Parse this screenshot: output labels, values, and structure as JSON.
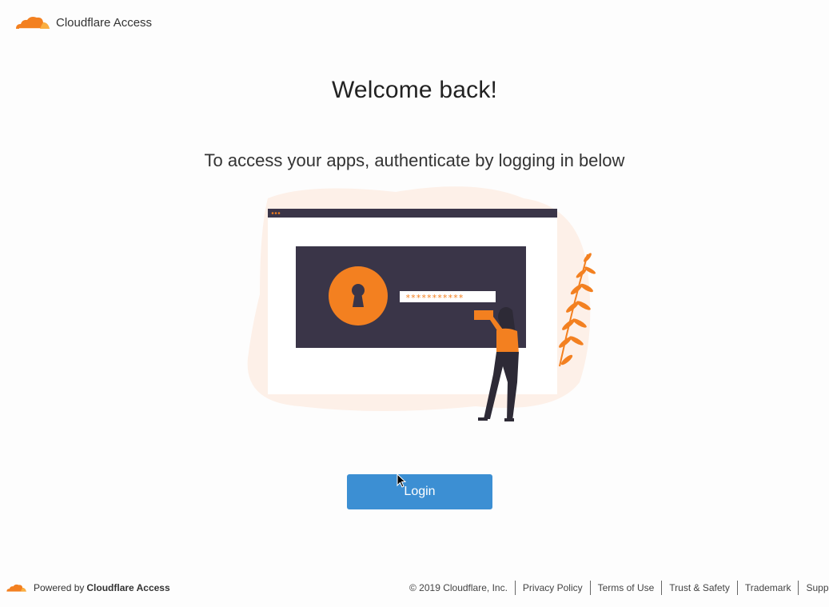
{
  "header": {
    "brand": "Cloudflare Access",
    "logo_icon": "cloudflare-cloud-icon"
  },
  "main": {
    "title": "Welcome back!",
    "subtitle": "To access your apps, authenticate by logging in below",
    "login_label": "Login",
    "password_mask": "***********"
  },
  "footer": {
    "powered_prefix": "Powered by",
    "powered_brand": "Cloudflare Access",
    "copyright": "© 2019 Cloudflare, Inc.",
    "links": [
      "Privacy Policy",
      "Terms of Use",
      "Trust & Safety",
      "Trademark",
      "Support"
    ]
  },
  "colors": {
    "accent": "#f38020",
    "button": "#3c8fd3",
    "dark": "#3a3548"
  }
}
